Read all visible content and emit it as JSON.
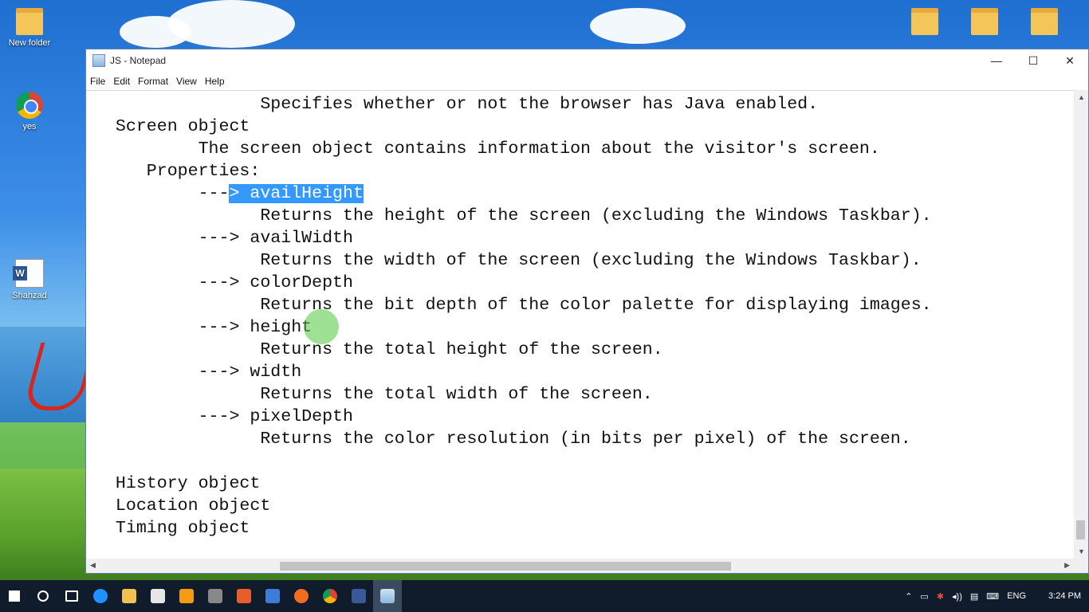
{
  "desktop": {
    "icons": [
      {
        "label": "New folder",
        "type": "folder-icon"
      },
      {
        "label": "yes",
        "type": "chrome-icon"
      },
      {
        "label": "Shahzad",
        "type": "word-doc-icon"
      }
    ]
  },
  "window": {
    "title": "JS - Notepad",
    "controls": {
      "minimize": "—",
      "maximize": "☐",
      "close": "✕"
    },
    "menu": [
      "File",
      "Edit",
      "Format",
      "View",
      "Help"
    ]
  },
  "editor": {
    "lines": [
      "                Specifies whether or not the browser has Java enabled.",
      "  Screen object",
      "          The screen object contains information about the visitor's screen.",
      "     Properties:",
      "          ---",
      "                Returns the height of the screen (excluding the Windows Taskbar).",
      "          ---> availWidth",
      "                Returns the width of the screen (excluding the Windows Taskbar).",
      "          ---> colorDepth",
      "                Returns the bit depth of the color palette for displaying images.",
      "          ---> height",
      "                Returns the total height of the screen.",
      "          ---> width",
      "                Returns the total width of the screen.",
      "          ---> pixelDepth",
      "                Returns the color resolution (in bits per pixel) of the screen.",
      "",
      "  History object",
      "  Location object",
      "  Timing object"
    ],
    "selected_text": "> availHeight"
  },
  "taskbar": {
    "language": "ENG",
    "time": "3:24 PM"
  },
  "colors": {
    "selection": "#3399ff",
    "taskbar": "#101b2b"
  }
}
